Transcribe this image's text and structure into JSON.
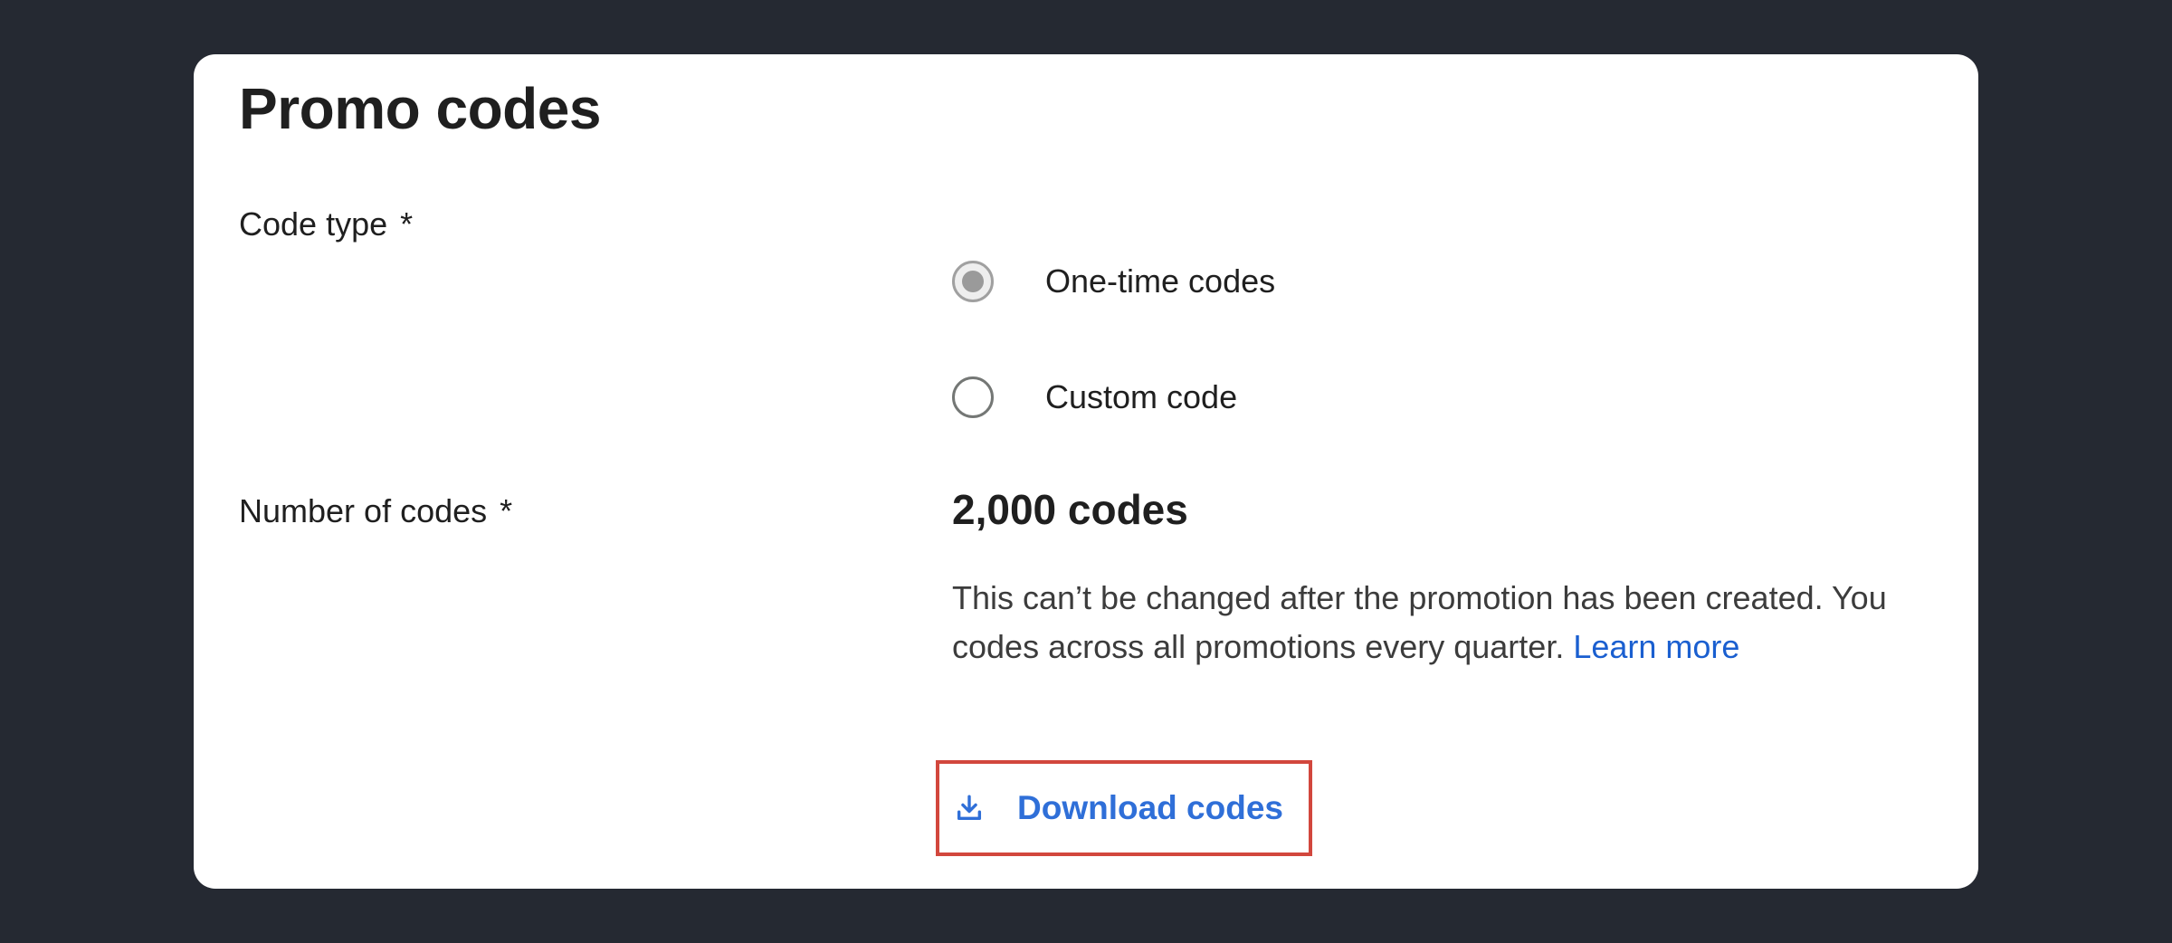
{
  "page": {
    "title": "Promo codes"
  },
  "code_type": {
    "label": "Code type",
    "required_marker": "*",
    "options": [
      {
        "label": "One-time codes",
        "selected": true
      },
      {
        "label": "Custom code",
        "selected": false
      }
    ]
  },
  "number_of_codes": {
    "label": "Number of codes",
    "required_marker": "*",
    "value": "2,000 codes",
    "help_line_1": "This can’t be changed after the promotion has been created. You",
    "help_line_2": "codes across all promotions every quarter.",
    "learn_more_label": "Learn more"
  },
  "download": {
    "label": "Download codes",
    "icon": "download-icon"
  },
  "colors": {
    "background": "#252932",
    "card": "#ffffff",
    "link": "#1a5fd0",
    "button_text": "#2f6fd8",
    "highlight": "#d2473d"
  }
}
